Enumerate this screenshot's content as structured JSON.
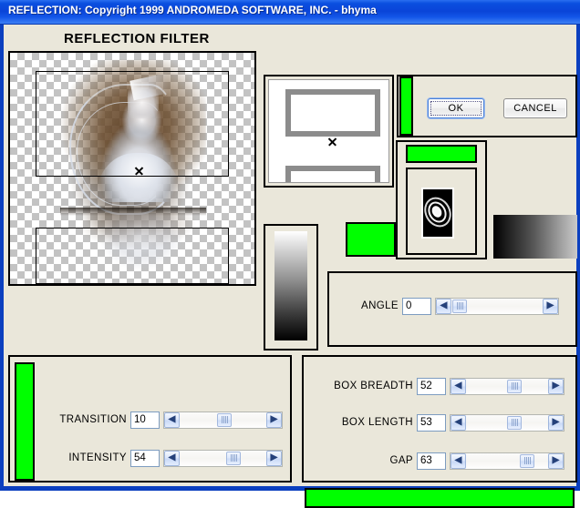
{
  "window": {
    "title": "REFLECTION: Copyright 1999 ANDROMEDA SOFTWARE, INC.  -  bhyma",
    "heading": "REFLECTION FILTER",
    "frame_color": "#0b3fbf",
    "client_background": "#eae7da",
    "accent_green": "#00ff00"
  },
  "buttons": {
    "ok": "OK",
    "cancel": "CANCEL"
  },
  "icons": {
    "left_arrow": "◀",
    "right_arrow": "▶"
  },
  "preview": {
    "name": "reflection-preview",
    "description": "checkerboard transparency with winged figure artwork and mirrored reflection"
  },
  "sliders": {
    "angle": {
      "label": "ANGLE",
      "value": "0",
      "percent": 0
    },
    "transition": {
      "label": "TRANSITION",
      "value": "10",
      "percent": 45
    },
    "intensity": {
      "label": "INTENSITY",
      "value": "54",
      "percent": 52
    },
    "box_breadth": {
      "label": "BOX BREADTH",
      "value": "52",
      "percent": 52
    },
    "box_length": {
      "label": "BOX LENGTH",
      "value": "53",
      "percent": 53
    },
    "gap": {
      "label": "GAP",
      "value": "63",
      "percent": 63
    }
  },
  "gradients": {
    "vertical": {
      "from": "#ffffff",
      "to": "#000000"
    },
    "horizontal": {
      "from": "#000000",
      "to": "#c9c9c9"
    }
  }
}
